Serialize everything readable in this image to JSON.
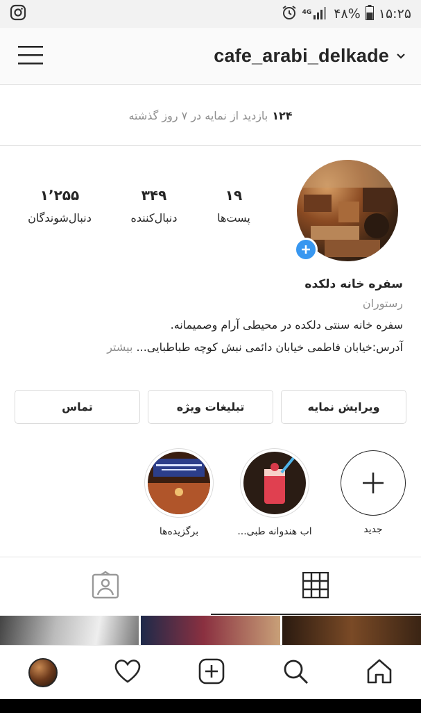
{
  "status_bar": {
    "app_icon": "instagram-icon",
    "network": "4G",
    "battery": "۴۸%",
    "time": "۱۵:۲۵"
  },
  "header": {
    "username": "cafe_arabi_delkade",
    "menu_icon": "hamburger-menu-icon",
    "dropdown_icon": "chevron-down-icon"
  },
  "insights": {
    "count": "۱۲۴",
    "text": "بازدید از نمایه در ۷ روز گذشته"
  },
  "profile": {
    "stats": [
      {
        "value": "۱۹",
        "label": "پست‌ها"
      },
      {
        "value": "۳۴۹",
        "label": "دنبال‌کننده"
      },
      {
        "value": "۱٬۲۵۵",
        "label": "دنبال‌شوندگان"
      }
    ],
    "name": "سفره خانه دلکده",
    "category": "رستوران",
    "bio_line1": "سفره خانه سنتی دلکده در محیطی آرام وصمیمانه.",
    "bio_line2": "آدرس:خیابان فاطمی خیابان دائمی نبش کوچه طباطبایی...",
    "more": "بیشتر"
  },
  "buttons": {
    "edit_profile": "ویرایش نمایه",
    "promotions": "تبلیغات ویژه",
    "contact": "تماس"
  },
  "highlights": [
    {
      "label": "جدید"
    },
    {
      "label": "اب هندوانه طبی..."
    },
    {
      "label": "برگزیده‌ها"
    }
  ],
  "tabs": [
    {
      "icon": "grid-icon",
      "active": true
    },
    {
      "icon": "tagged-person-icon",
      "active": false
    }
  ],
  "bottom_nav": [
    {
      "icon": "home-icon"
    },
    {
      "icon": "search-icon"
    },
    {
      "icon": "new-post-icon"
    },
    {
      "icon": "heart-icon"
    },
    {
      "icon": "profile-avatar-icon"
    }
  ],
  "colors": {
    "accent_blue": "#3897f0",
    "text": "#262626",
    "muted": "#8e8e8e",
    "border": "#dbdbdb"
  }
}
